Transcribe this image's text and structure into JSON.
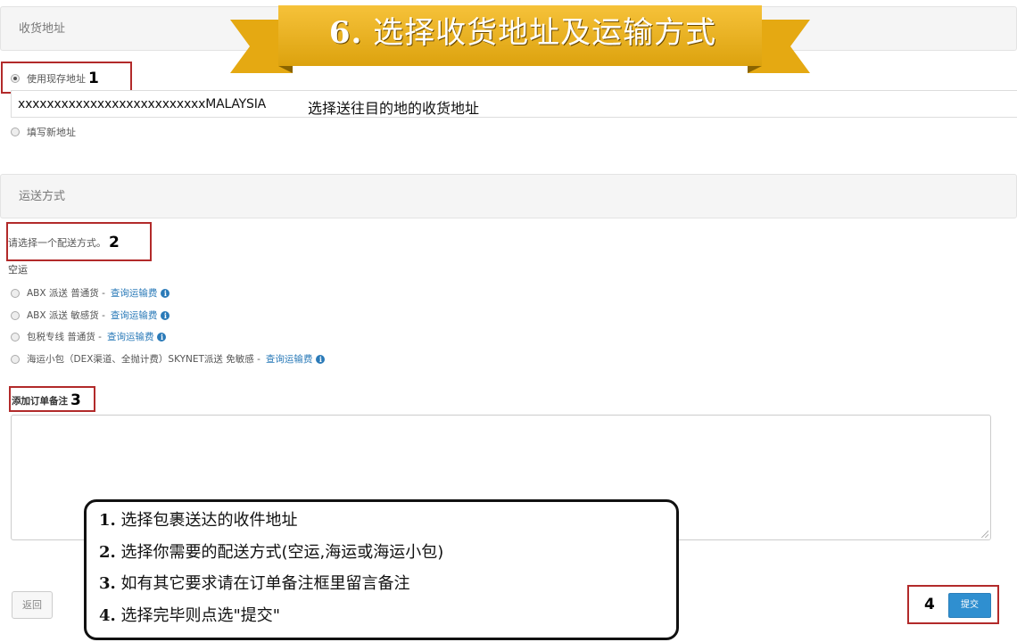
{
  "address_section": {
    "header": "收货地址",
    "use_existing_label": "使用现存地址",
    "callout_1": "1",
    "address_value": "xxxxxxxxxxxxxxxxxxxxxxxxxxMALAYSIA",
    "address_hint": "选择送往目的地的收货地址",
    "new_address_label": "填写新地址"
  },
  "shipping_section": {
    "header": "运送方式",
    "prompt": "请选择一个配送方式。",
    "callout_2": "2",
    "group_label": "空运",
    "options": [
      {
        "label": "ABX 派送 普通货 -",
        "link": "查询运输费"
      },
      {
        "label": "ABX 派送 敏感货 -",
        "link": "查询运输费"
      },
      {
        "label": "包税专线 普通货 -",
        "link": "查询运输费"
      },
      {
        "label": "海运小包（DEX渠道、全抛计费）SKYNET派送 免敏感 -",
        "link": "查询运输费"
      }
    ],
    "info_glyph": "i"
  },
  "notes_section": {
    "label": "添加订单备注",
    "callout_3": "3",
    "value": ""
  },
  "footer": {
    "back_label": "返回",
    "callout_4": "4",
    "submit_label": "提交"
  },
  "banner": {
    "number": "6.",
    "title": "选择收货地址及运输方式"
  },
  "instructions": [
    {
      "num": "1.",
      "text": "选择包裹送达的收件地址"
    },
    {
      "num": "2.",
      "text": "选择你需要的配送方式(空运,海运或海运小包)"
    },
    {
      "num": "3.",
      "text": "如有其它要求请在订单备注框里留言备注"
    },
    {
      "num": "4.",
      "text": "选择完毕则点选\"提交\""
    }
  ],
  "colors": {
    "callout_border": "#b22a2a",
    "link": "#2a7ab8",
    "submit_bg": "#2f8fd0",
    "banner_gold": "#e8ad12"
  }
}
